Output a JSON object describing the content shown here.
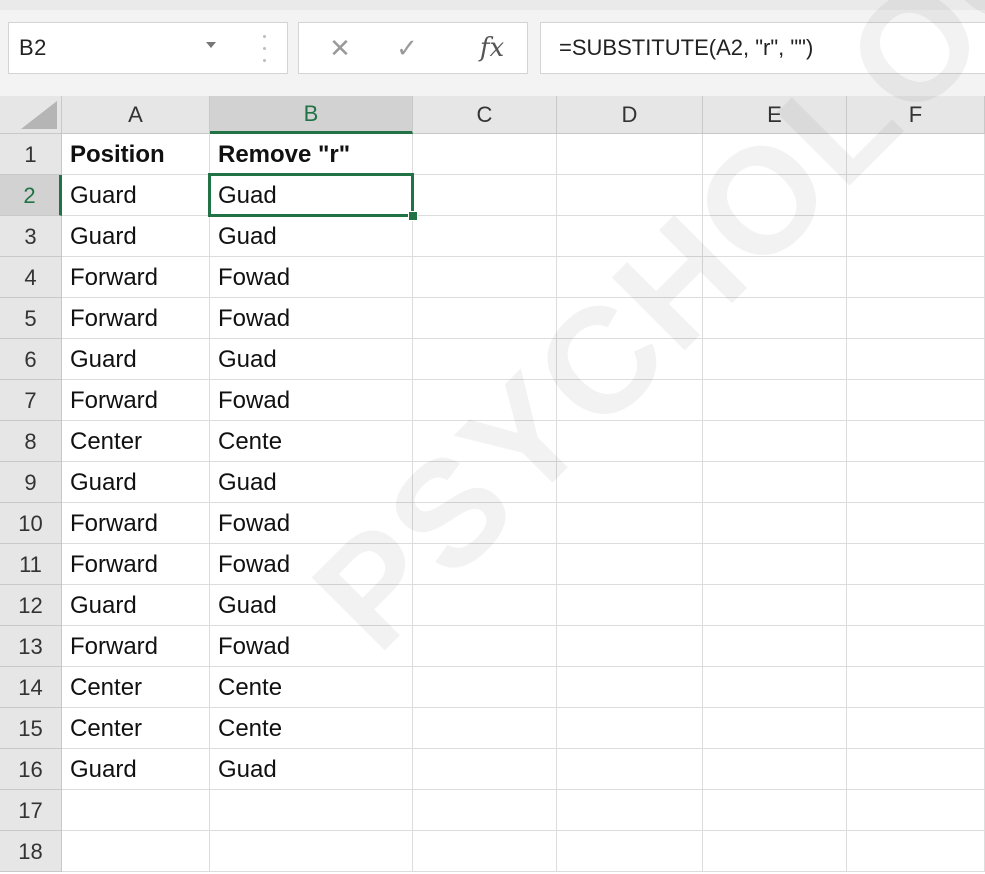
{
  "formula_bar": {
    "name_box": "B2",
    "cancel_icon": "close-icon",
    "enter_icon": "check-icon",
    "fx_label": "fx",
    "formula": "=SUBSTITUTE(A2, \"r\", \"\")"
  },
  "columns": [
    "A",
    "B",
    "C",
    "D",
    "E",
    "F"
  ],
  "rows": [
    "1",
    "2",
    "3",
    "4",
    "5",
    "6",
    "7",
    "8",
    "9",
    "10",
    "11",
    "12",
    "13",
    "14",
    "15",
    "16",
    "17",
    "18"
  ],
  "cells": {
    "A": [
      "Position",
      "Guard",
      "Guard",
      "Forward",
      "Forward",
      "Guard",
      "Forward",
      "Center",
      "Guard",
      "Forward",
      "Forward",
      "Guard",
      "Forward",
      "Center",
      "Center",
      "Guard",
      "",
      ""
    ],
    "B": [
      "Remove \"r\"",
      "Guad",
      "Guad",
      "Fowad",
      "Fowad",
      "Guad",
      "Fowad",
      "Cente",
      "Guad",
      "Fowad",
      "Fowad",
      "Guad",
      "Fowad",
      "Cente",
      "Cente",
      "Guad",
      "",
      ""
    ]
  },
  "active_cell": "B2",
  "watermark": "PSYCHOLOGY.S",
  "colors": {
    "accent": "#217346",
    "header_bg": "#e6e6e6"
  }
}
